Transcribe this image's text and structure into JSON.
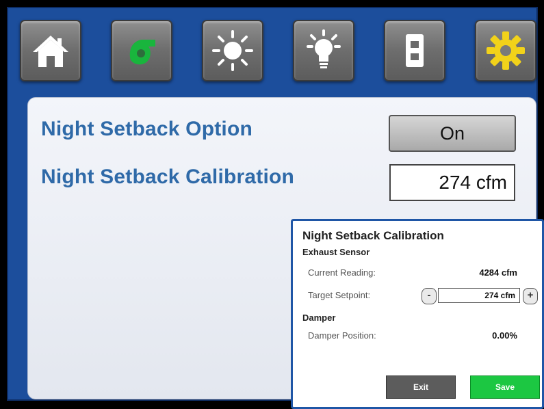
{
  "toolbar": {
    "icons": [
      "home-icon",
      "fan-icon",
      "sun-icon",
      "light-bulb-icon",
      "switch-plate-icon",
      "gear-icon"
    ],
    "active_color": "#19b53d",
    "gear_color": "#f2d21a"
  },
  "main": {
    "option_label": "Night Setback Option",
    "option_value": "On",
    "calibration_label": "Night Setback Calibration",
    "calibration_value": "274 cfm"
  },
  "dialog": {
    "title": "Night Setback Calibration",
    "exhaust_section": "Exhaust Sensor",
    "current_reading_label": "Current Reading:",
    "current_reading_value": "4284 cfm",
    "target_setpoint_label": "Target Setpoint:",
    "target_setpoint_value": "274 cfm",
    "decrement_label": "-",
    "increment_label": "+",
    "damper_section": "Damper",
    "damper_position_label": "Damper Position:",
    "damper_position_value": "0.00%",
    "exit_label": "Exit",
    "save_label": "Save"
  },
  "colors": {
    "screen_bg": "#1c4e9c",
    "label_blue": "#2f6aa8",
    "save_green": "#1cc742"
  }
}
